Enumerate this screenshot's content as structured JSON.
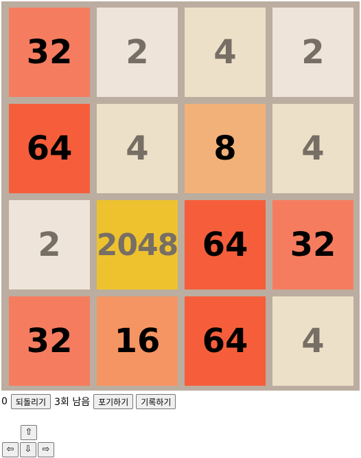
{
  "board": {
    "rows": [
      [
        32,
        2,
        4,
        2
      ],
      [
        64,
        4,
        8,
        4
      ],
      [
        2,
        2048,
        64,
        32
      ],
      [
        32,
        16,
        64,
        4
      ]
    ],
    "tile_colors": {
      "2": "#eee4da",
      "4": "#ede0c8",
      "8": "#f2b179",
      "16": "#f59563",
      "32": "#f67c5f",
      "64": "#f65e3b",
      "2048": "#edc22e"
    },
    "background_color": "#bbada0"
  },
  "controls": {
    "score": "0",
    "undo_label": "되돌리기",
    "undo_remaining": "3회 남음",
    "give_up_label": "포기하기",
    "record_label": "기록하기"
  },
  "arrows": {
    "up": "⇧",
    "left": "⇦",
    "down": "⇩",
    "right": "⇨"
  }
}
